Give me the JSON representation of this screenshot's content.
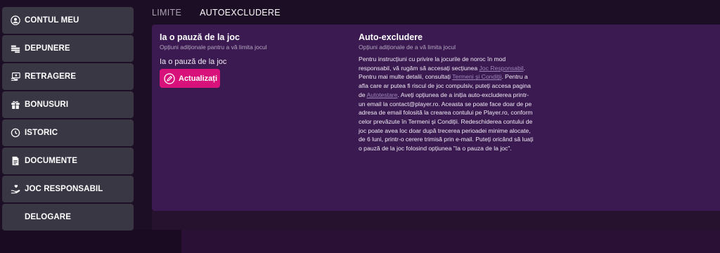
{
  "sidebar": {
    "items": [
      {
        "label": "CONTUL MEU",
        "icon": "user-circle-icon"
      },
      {
        "label": "DEPUNERE",
        "icon": "coins-icon"
      },
      {
        "label": "RETRAGERE",
        "icon": "cash-withdraw-icon"
      },
      {
        "label": "BONUSURI",
        "icon": "gift-icon"
      },
      {
        "label": "ISTORIC",
        "icon": "history-icon"
      },
      {
        "label": "DOCUMENTE",
        "icon": "document-icon"
      },
      {
        "label": "JOC RESPONSABIL",
        "icon": "hand-heart-icon"
      },
      {
        "label": "DELOGARE",
        "icon": ""
      }
    ]
  },
  "tabs": [
    {
      "label": "LIMITE",
      "active": false
    },
    {
      "label": "AUTOEXCLUDERE",
      "active": true
    }
  ],
  "pause": {
    "title": "Ia o pauză de la joc",
    "subtitle": "Opțiuni adiționale pantru a vă limita jocul",
    "label": "Ia o pauză de la joc",
    "button_label": "Actualizați"
  },
  "self_exclusion": {
    "title": "Auto-excludere",
    "subtitle": "Opțiuni adiționale de a vă limita jocul",
    "body": {
      "t1": "Pentru instrucțiuni cu privire la jocurile de noroc în mod responsabil, vă rugăm să accesați secțiunea ",
      "link1": "Joc Responsabil",
      "t2": ". Pentru mai multe detalii, consultați ",
      "link2": "Termeni și Condiții",
      "t3": ". Pentru a afla care ar putea fi riscul de joc compulsiv, puteți accesa pagina de ",
      "link3": "Autotestare",
      "t4": ". Aveți opțiunea de a iniția auto-excluderea printr-un email la contact@player.ro. Aceasta se poate face doar de pe adresa de email folosită la crearea contului pe Player.ro, conform celor prevăzute în Termeni și Condiții. Redeschiderea contului de joc poate avea loc doar după trecerea perioadei minime alocate, de 6 luni, printr-o cerere trimisă prin e-mail. Puteți oricând să luați o pauză de la joc folosind opțiunea \"Ia o pauza de la joc\"."
    }
  },
  "colors": {
    "sidebar_item_bg": "#3a3745",
    "panel_bg": "#3b1a52",
    "accent": "#d8127a",
    "link": "#9d85b8"
  }
}
